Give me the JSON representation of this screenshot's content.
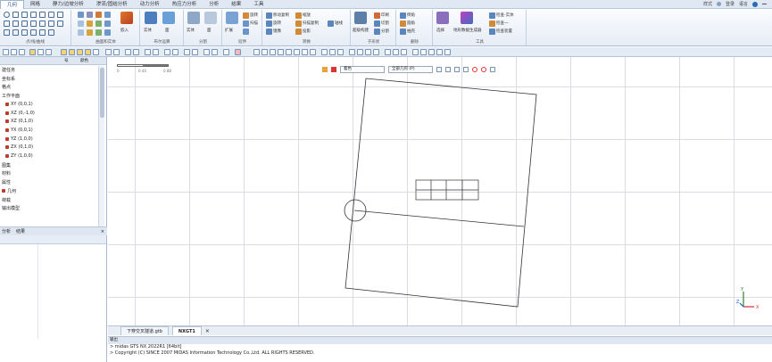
{
  "menu": {
    "tabs": [
      "几何",
      "网格",
      "静力/边坡分析",
      "渗流/固结分析",
      "动力分析",
      "热应力分析",
      "分析",
      "结果",
      "工具"
    ],
    "active_index": 0,
    "right": {
      "style": "样式",
      "login": "登录",
      "language": "语言"
    }
  },
  "ribbon": {
    "groups": [
      {
        "label": "点/线/曲线"
      },
      {
        "label": "曲面和实体"
      },
      {
        "label": "布尔运算"
      },
      {
        "label": "分割"
      },
      {
        "label": "延伸"
      },
      {
        "label": "转换"
      },
      {
        "label": "子形状"
      },
      {
        "label": "删除"
      },
      {
        "label": "工具"
      }
    ],
    "items": {
      "extrude": "扩展",
      "revolve": "旋转",
      "sweep": "扫描",
      "move_copy": "移动复制",
      "rotate": "旋转",
      "mirror": "镜像",
      "scale": "缩放",
      "scan_copy": "扫描复制",
      "projection": "投影",
      "solid_a": "实体",
      "surface_a": "面",
      "solid_b": "实体",
      "surface_b": "面",
      "embed": "嵌入",
      "axis": "轴线",
      "imprint": "印刷",
      "split_sub": "切割",
      "split_tool": "分割",
      "construct": "超级构建",
      "chamfer": "倒角",
      "fillet": "圆角",
      "shell": "抽壳",
      "select": "选择",
      "terrain": "地形数据生成器",
      "model_check": "检查一",
      "check_all": "检查装置",
      "geometry_check": "检查-实体",
      "nearest": "选择"
    }
  },
  "tree": {
    "header": {
      "col1": "",
      "col2": "号",
      "col3": "颜色"
    },
    "items": [
      {
        "label": "建任务",
        "icon": false,
        "indent": 0
      },
      {
        "label": "坐标系",
        "icon": false,
        "indent": 0
      },
      {
        "label": "格点",
        "icon": false,
        "indent": 0
      },
      {
        "label": "工作平面",
        "icon": false,
        "indent": 0
      },
      {
        "label": "XY (0,0,1)",
        "icon": true,
        "indent": 1
      },
      {
        "label": "XZ (0,-1,0)",
        "icon": true,
        "indent": 1
      },
      {
        "label": "XZ (0,1,0)",
        "icon": true,
        "indent": 1
      },
      {
        "label": "YX (0,0,1)",
        "icon": true,
        "indent": 1
      },
      {
        "label": "YZ (1,0,0)",
        "icon": true,
        "indent": 1
      },
      {
        "label": "ZX (0,1,0)",
        "icon": true,
        "indent": 1
      },
      {
        "label": "ZY (1,0,0)",
        "icon": true,
        "indent": 1
      },
      {
        "label": "图集",
        "icon": false,
        "indent": 0
      },
      {
        "label": "材料",
        "icon": false,
        "indent": 0
      },
      {
        "label": "属性",
        "icon": false,
        "indent": 0
      },
      {
        "label": "几何",
        "icon": true,
        "indent": 0
      },
      {
        "label": "荷载",
        "icon": false,
        "indent": 0
      },
      {
        "label": "输出模型",
        "icon": false,
        "indent": 0
      }
    ]
  },
  "left_tabs": [
    "分析",
    "结果"
  ],
  "viewport": {
    "toolbar": {
      "mode": "着色",
      "filter": "全部几何 (P)"
    },
    "ruler": {
      "ticks": [
        "0",
        "0.44",
        "0.88"
      ]
    }
  },
  "doc_tabs": [
    {
      "label": "下穿交叉隧道.gtb",
      "active": false
    },
    {
      "label": "NXGT1",
      "active": true
    }
  ],
  "output": {
    "title": "输出",
    "lines": [
      "> midas GTS NX 2022R1 [64bit]",
      "> Copyright (C) SINCE 2007 MIDAS Information Technology Co.,Ltd. ALL RIGHTS RESERVED."
    ]
  },
  "colors": {
    "ribbon_bg": "#e6edf6",
    "accent": "#1e4f8c",
    "grid": "#d9dde3",
    "axis_x": "#d32f2f",
    "axis_y": "#2e7d32",
    "axis_z": "#1565c0"
  }
}
